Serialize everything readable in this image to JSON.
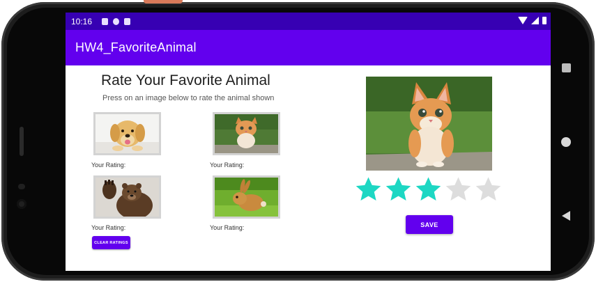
{
  "status_bar": {
    "time": "10:16",
    "left_icons": [
      "a-icon",
      "settings-p-icon",
      "sim-card-icon"
    ],
    "right_icons": [
      "wifi-icon",
      "signal-icon",
      "battery-icon"
    ]
  },
  "app_bar": {
    "title": "HW4_FavoriteAnimal"
  },
  "main": {
    "heading": "Rate Your Favorite Animal",
    "subheading": "Press on an image below to rate the animal shown"
  },
  "animals": [
    {
      "name": "dog",
      "rating_label": "Your Rating:"
    },
    {
      "name": "kitten",
      "rating_label": "Your Rating:"
    },
    {
      "name": "bear",
      "rating_label": "Your Rating:"
    },
    {
      "name": "rabbit",
      "rating_label": "Your Rating:"
    }
  ],
  "buttons": {
    "clear_label": "CLEAR RATINGS",
    "save_label": "SAVE"
  },
  "rating_bar": {
    "rating": 3,
    "max": 5
  },
  "colors": {
    "status_bar": "#3700b3",
    "app_bar": "#6200ee",
    "button": "#6200ee",
    "star_filled": "#1dd7c3",
    "star_empty": "#dddddd"
  }
}
